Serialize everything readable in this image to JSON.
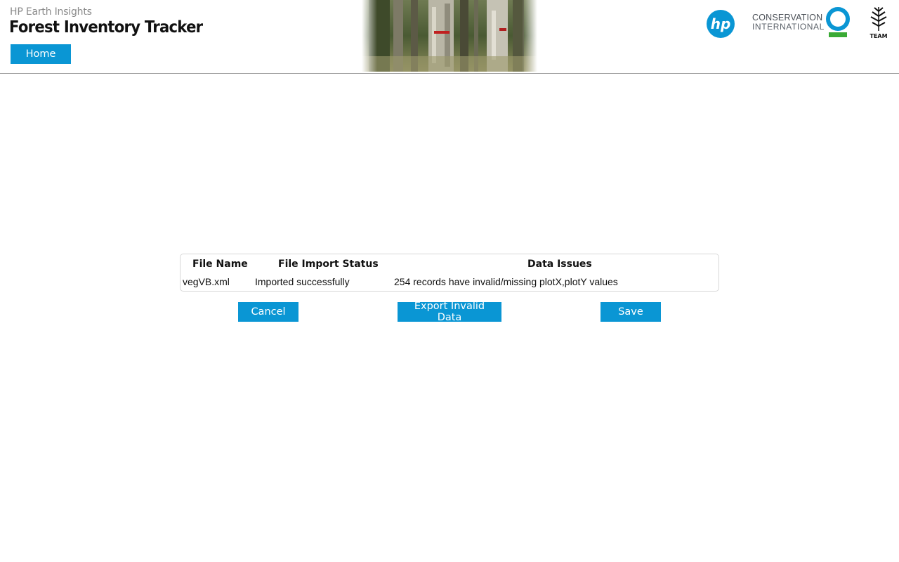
{
  "header": {
    "app_subtitle": "HP Earth Insights",
    "app_title": "Forest Inventory Tracker",
    "home_label": "Home",
    "conservation_line1": "CONSERVATION",
    "conservation_line2": "INTERNATIONAL",
    "hp_logo_text": "hp",
    "team_logo_text": "TEAM",
    "banner_image": "forest-trees-photo"
  },
  "colors": {
    "accent": "#0a96d4",
    "ci_blue": "#0a96d4",
    "ci_green": "#3aaa35"
  },
  "import_table": {
    "columns": [
      "File Name",
      "File Import Status",
      "Data Issues"
    ],
    "rows": [
      [
        "vegVB.xml",
        "Imported successfully",
        "254 records have invalid/missing plotX,plotY values"
      ]
    ]
  },
  "actions": {
    "cancel": "Cancel",
    "export": "Export Invalid Data",
    "save": "Save"
  }
}
